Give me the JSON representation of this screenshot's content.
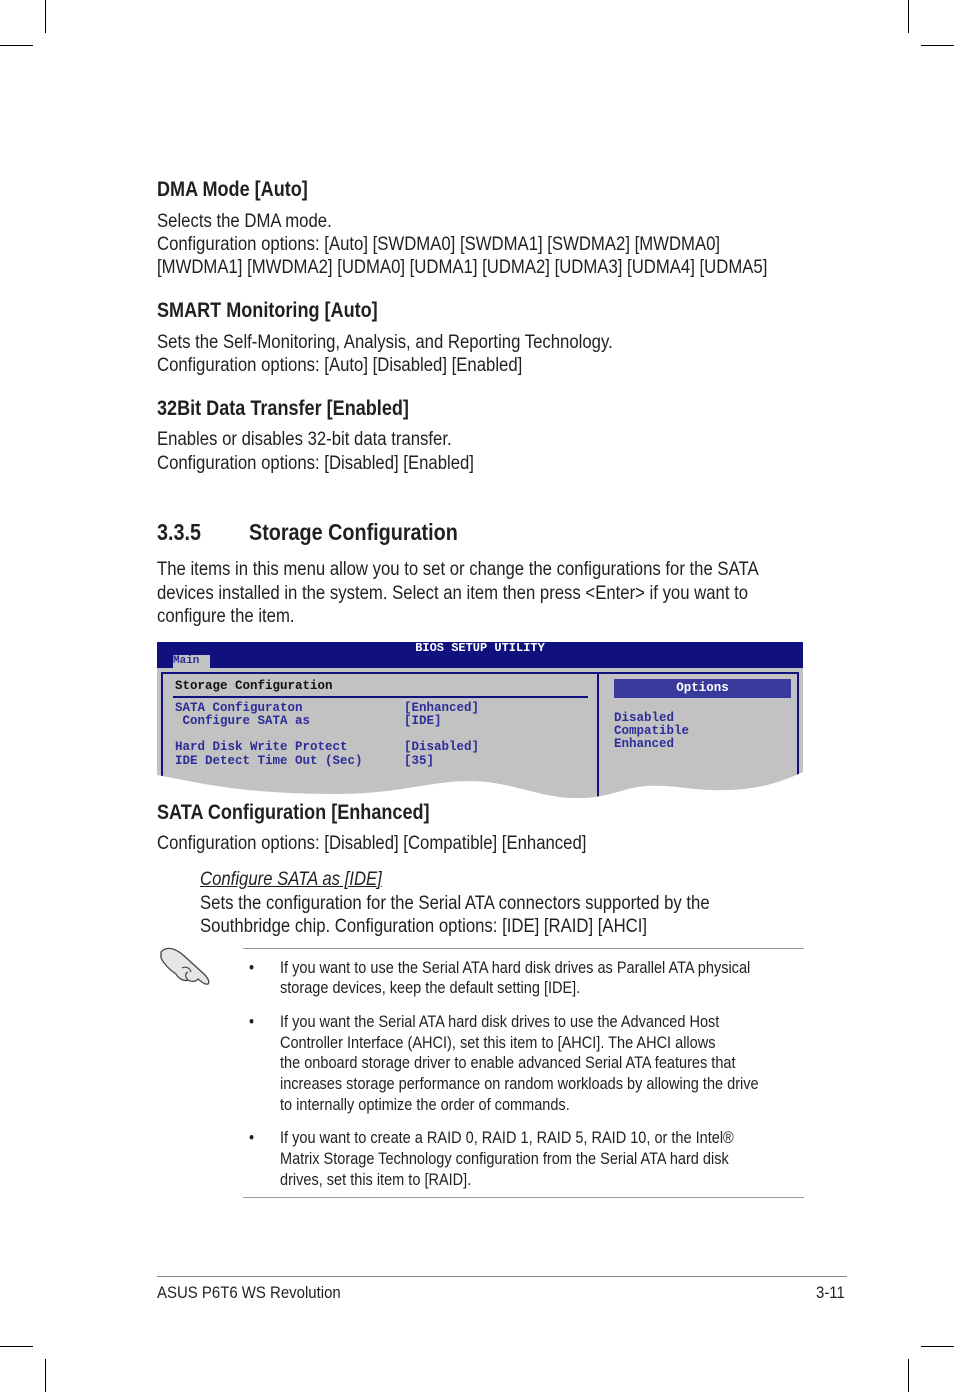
{
  "dma": {
    "heading": "DMA Mode [Auto]",
    "lines": [
      "Selects the DMA mode.",
      "Configuration options: [Auto] [SWDMA0] [SWDMA1] [SWDMA2] [MWDMA0]",
      "[MWDMA1] [MWDMA2] [UDMA0] [UDMA1] [UDMA2] [UDMA3] [UDMA4] [UDMA5]"
    ]
  },
  "smart": {
    "heading": "SMART Monitoring [Auto]",
    "lines": [
      "Sets the Self-Monitoring, Analysis, and Reporting Technology.",
      "Configuration options: [Auto] [Disabled] [Enabled]"
    ]
  },
  "bit32": {
    "heading": "32Bit Data Transfer [Enabled]",
    "lines": [
      "Enables or disables 32-bit data transfer.",
      "Configuration options: [Disabled] [Enabled]"
    ]
  },
  "section": {
    "number": "3.3.5",
    "title": "Storage Configuration",
    "lines": [
      "The items in this menu allow you to set or change the configurations for the SATA",
      "devices installed in the system. Select an item then press <Enter> if you want to",
      "configure the item."
    ]
  },
  "bios": {
    "title": "BIOS SETUP UTILITY",
    "tab": "Main",
    "panel_title": "Storage Configuration",
    "items": [
      {
        "label": "SATA Configuraton",
        "value": "[Enhanced]"
      },
      {
        "label": " Configure SATA as",
        "value": "[IDE]"
      },
      {
        "label": "Hard Disk Write Protect",
        "value": "[Disabled]"
      },
      {
        "label": "IDE Detect Time Out (Sec)",
        "value": "[35]"
      }
    ],
    "options_title": "Options",
    "options": [
      "Disabled",
      "Compatible",
      "Enhanced"
    ],
    "colors": {
      "navy": "#10107e",
      "gray": "#c2c2c2",
      "text": "#2d2d9a"
    }
  },
  "sata": {
    "heading": "SATA Configuration [Enhanced]",
    "lines": [
      "Configuration options: [Disabled] [Compatible] [Enhanced]"
    ]
  },
  "configure": {
    "heading": "Configure SATA as [IDE]",
    "lines": [
      "Sets the configuration for the Serial ATA connectors supported by the",
      "Southbridge chip. Configuration options: [IDE] [RAID] [AHCI]"
    ]
  },
  "note": {
    "icon": "pointing-hand-icon",
    "bullets": [
      [
        "If you want to use the Serial ATA hard disk drives as Parallel ATA physical",
        "storage devices, keep the default setting [IDE]."
      ],
      [
        "If you want the Serial ATA hard disk drives to use the Advanced Host",
        "Controller Interface (AHCI), set this item to [AHCI]. The AHCI allows",
        "the onboard storage driver to enable advanced Serial ATA features that",
        "increases storage performance on random workloads by allowing the drive",
        "to internally optimize the order of commands."
      ],
      [
        "If you want to create a RAID 0, RAID 1, RAID 5, RAID 10, or the Intel®",
        "Matrix Storage Technology configuration from the Serial ATA hard disk",
        "drives, set this item to [RAID]."
      ]
    ]
  },
  "footer": {
    "left": "ASUS P6T6 WS Revolution",
    "right": "3-11"
  }
}
